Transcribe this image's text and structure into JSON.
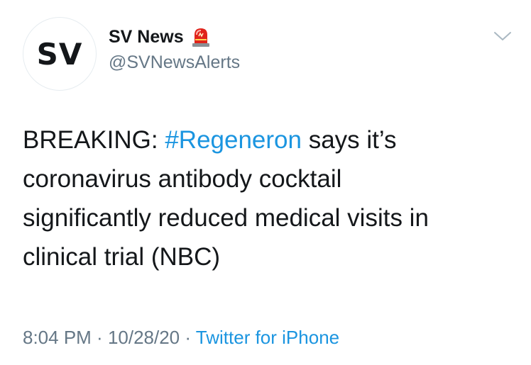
{
  "author": {
    "avatar_text": "SV",
    "display_name": "SV News",
    "badge_icon": "siren-icon",
    "handle": "@SVNewsAlerts"
  },
  "menu": {
    "icon": "chevron-down-icon"
  },
  "tweet": {
    "text_before": "BREAKING: ",
    "hashtag": "#Regeneron",
    "text_after": " says it’s\ncoronavirus antibody cocktail\nsignificantly reduced medical visits in\nclinical trial (NBC)"
  },
  "meta": {
    "time": "8:04 PM",
    "separator1": " · ",
    "date": "10/28/20",
    "separator2": " · ",
    "source": "Twitter for iPhone"
  },
  "colors": {
    "link": "#1b95e0",
    "secondary_text": "#657786",
    "primary_text": "#14171a",
    "siren_red": "#e0241b"
  }
}
